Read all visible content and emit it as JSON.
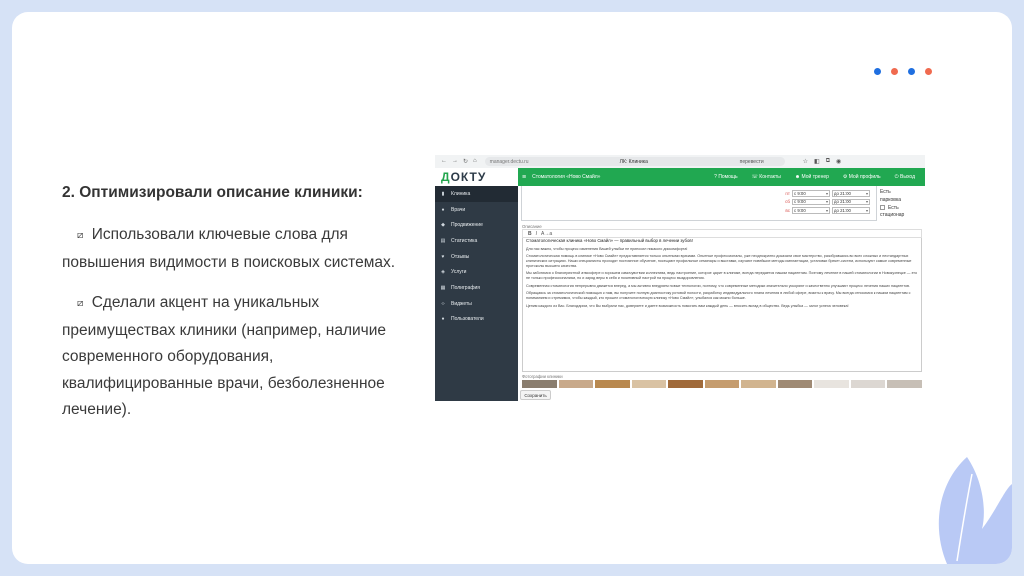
{
  "slide": {
    "heading": "2. Оптимизировали описание клиники:",
    "bullet_mark": "⧄",
    "bullets": [
      "Использовали ключевые слова для повышения видимости в поисковых системах.",
      "Сделали акцент на уникальных преимуществах клиники (например, наличие современного оборудования, квалифицированные врачи, безболезненное лечение)."
    ],
    "dot_colors": [
      "#1f6fe0",
      "#f06a4f",
      "#1f6fe0",
      "#f06a4f"
    ],
    "accent_color": "#b9c9f5"
  },
  "screenshot": {
    "browser": {
      "url": "manager.dectu.ru",
      "tab_title": "ЛК: Клиника",
      "reading_mode": "перевести"
    },
    "logo": {
      "part1": "Д",
      "part2": "ОКТУ"
    },
    "sidebar": {
      "items": [
        {
          "label": "Клиника",
          "icon": "clinic-icon",
          "glyph": "▮"
        },
        {
          "label": "Врачи",
          "icon": "doctor-icon",
          "glyph": "●"
        },
        {
          "label": "Продвижение",
          "icon": "megaphone-icon",
          "glyph": "◆"
        },
        {
          "label": "Статистика",
          "icon": "chart-icon",
          "glyph": "▤"
        },
        {
          "label": "Отзывы",
          "icon": "heart-icon",
          "glyph": "♥"
        },
        {
          "label": "Услуги",
          "icon": "tag-icon",
          "glyph": "◈"
        },
        {
          "label": "Полиграфия",
          "icon": "print-icon",
          "glyph": "▦"
        },
        {
          "label": "Виджеты",
          "icon": "code-icon",
          "glyph": "‹›"
        },
        {
          "label": "Пользователи",
          "icon": "user-icon",
          "glyph": "●"
        }
      ]
    },
    "topbar": {
      "clinic": "Стоматология «Ново Смайл»",
      "help": "Помощь",
      "contacts": "Контакты",
      "manager": "Мой тренер",
      "profile": "Мой профиль",
      "logout": "Выход"
    },
    "schedule": [
      {
        "day": "пт",
        "from": "с 9:00",
        "to": "до 21:00"
      },
      {
        "day": "сб",
        "from": "с 9:00",
        "to": "до 21:00"
      },
      {
        "day": "вс",
        "from": "с 9:00",
        "to": "до 21:00"
      }
    ],
    "parking": {
      "line1": "Есть",
      "line2": "парковка",
      "line3": "Есть",
      "line4": "стационар"
    },
    "description": {
      "label": "Описание",
      "toolbar": [
        "B",
        "I",
        "A→a"
      ],
      "paragraphs": [
        "Стоматологическая клиника «Ново Смайл» — правильный выбор в лечении зубов!",
        "Для нас важно, чтобы процесс изменения Вашей улыбки не приносил никакого дискомфорта!",
        "Стоматологическая помощь в клинике «Ново Смайл» предоставляется только опытными врачами. Опытные профессионалы, уже неоднократно доказали свое мастерство, разобравшись во всех сложных и нестандартных клинических ситуациях. Наши специалисты проходят постоянное обучение, посещают профильные семинары и выставки, изучают новейшие методы имплантации, установки брекет-систем, используют самые современные протоколы высшего качества.",
        "Мы заботимся о благоприятной атмосфере и хорошем самочувствии коллектива, ведь настроение, которое царит в клинике, всегда передается нашим пациентам. Поэтому лечение в нашей стоматологии в Новокузнецке — это не только профессионализм, но и заряд веры в себя и позитивный настрой на процесс выздоровления.",
        "Современная стоматология непрерывно движется вперед, а мы активно внедряем новые технологии, поэтому, что современные методики значительно ускоряют и качественно улучшают процесс лечения наших пациентов.",
        "Обращаясь за стоматологической помощью к нам, вы получите полную диагностику ротовой полости, разработку индивидуального плана лечения в любой сфере, визиты к врачу. Мы всегда относимся к нашим пациентам с пониманием и стремимся, чтобы каждый, кто прошел стоматологическую клинику «Ново Смайл», улыбался как можно больше.",
        "Ценим каждого из Вас. Благодарим, что Вы выбрали нас, доверяете и даете возможность помогать вам каждый день — вносить вклад в общество. Ведь улыбка — залог успеха человека!"
      ]
    },
    "photos_label": "Фотографии клиники",
    "photo_colors": [
      "#8a7d6e",
      "#c8a98a",
      "#b9894f",
      "#d9c2a3",
      "#a06a3a",
      "#c59c6e",
      "#d1b48f",
      "#9f8a74",
      "#e8e4df",
      "#dcd7d2",
      "#c7bfb6"
    ],
    "save_label": "Сохранить"
  }
}
